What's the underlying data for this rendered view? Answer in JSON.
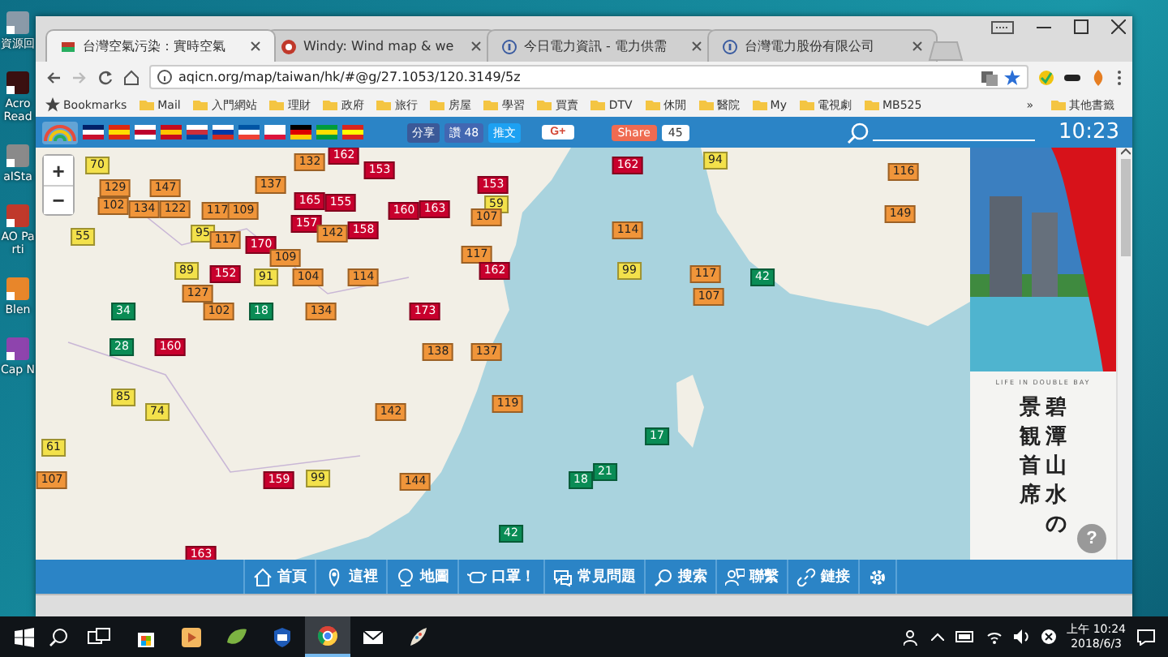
{
  "desktop": {
    "icons": [
      {
        "label": "資源回"
      },
      {
        "label": "Acro Read"
      },
      {
        "label": "aISta"
      },
      {
        "label": "AO Parti"
      },
      {
        "label": "Blen"
      },
      {
        "label": "Cap N"
      }
    ]
  },
  "browser": {
    "tabs": [
      {
        "title": "台灣空氣污染：實時空氣",
        "selected": true
      },
      {
        "title": "Windy: Wind map & we",
        "selected": false
      },
      {
        "title": "今日電力資訊 - 電力供需",
        "selected": false
      },
      {
        "title": "台灣電力股份有限公司",
        "selected": false
      }
    ],
    "address": "aqicn.org/map/taiwan/hk/#@g/27.1053/120.3149/5z",
    "bookmarks": [
      "Bookmarks",
      "Mail",
      "入門網站",
      "理財",
      "政府",
      "旅行",
      "房屋",
      "學習",
      "買賣",
      "DTV",
      "休閒",
      "醫院",
      "My",
      "電視劇",
      "MB525"
    ],
    "more": "»",
    "other_bookmarks": "其他書籤"
  },
  "site_toolbar": {
    "share": "分享",
    "like": "讚 48",
    "tweet": "推文",
    "gplus": "G+",
    "share_button": "Share",
    "share_count": "45",
    "time": "10:23"
  },
  "map": {
    "zoom_in": "+",
    "zoom_out": "−",
    "markers": [
      {
        "value": "70",
        "color": "#f3e14b"
      },
      {
        "value": "129",
        "color": "#f0953a"
      },
      {
        "value": "147",
        "color": "#f0953a"
      },
      {
        "value": "102",
        "color": "#f0953a"
      },
      {
        "value": "134",
        "color": "#f0953a"
      },
      {
        "value": "122",
        "color": "#f0953a"
      },
      {
        "value": "137",
        "color": "#f0953a"
      },
      {
        "value": "132",
        "color": "#f0953a"
      },
      {
        "value": "162",
        "color": "#c8002d"
      },
      {
        "value": "117",
        "color": "#f0953a"
      },
      {
        "value": "109",
        "color": "#f0953a"
      },
      {
        "value": "95",
        "color": "#f3e14b"
      },
      {
        "value": "117",
        "color": "#f0953a"
      },
      {
        "value": "170",
        "color": "#c8002d"
      },
      {
        "value": "109",
        "color": "#f0953a"
      },
      {
        "value": "157",
        "color": "#c8002d"
      },
      {
        "value": "142",
        "color": "#f0953a"
      },
      {
        "value": "158",
        "color": "#c8002d"
      },
      {
        "value": "165",
        "color": "#c8002d"
      },
      {
        "value": "155",
        "color": "#c8002d"
      },
      {
        "value": "153",
        "color": "#c8002d"
      },
      {
        "value": "160",
        "color": "#c8002d"
      },
      {
        "value": "163",
        "color": "#c8002d"
      },
      {
        "value": "153",
        "color": "#c8002d"
      },
      {
        "value": "59",
        "color": "#f3e14b"
      },
      {
        "value": "107",
        "color": "#f0953a"
      },
      {
        "value": "117",
        "color": "#f0953a"
      },
      {
        "value": "162",
        "color": "#c8002d"
      },
      {
        "value": "55",
        "color": "#f3e14b"
      },
      {
        "value": "89",
        "color": "#f3e14b"
      },
      {
        "value": "152",
        "color": "#c8002d"
      },
      {
        "value": "91",
        "color": "#f3e14b"
      },
      {
        "value": "104",
        "color": "#f0953a"
      },
      {
        "value": "114",
        "color": "#f0953a"
      },
      {
        "value": "127",
        "color": "#f0953a"
      },
      {
        "value": "34",
        "color": "#0a8c55"
      },
      {
        "value": "102",
        "color": "#f0953a"
      },
      {
        "value": "18",
        "color": "#0a8c55"
      },
      {
        "value": "134",
        "color": "#f0953a"
      },
      {
        "value": "173",
        "color": "#c8002d"
      },
      {
        "value": "28",
        "color": "#0a8c55"
      },
      {
        "value": "138",
        "color": "#f0953a"
      },
      {
        "value": "160",
        "color": "#c8002d"
      },
      {
        "value": "137",
        "color": "#f0953a"
      },
      {
        "value": "94",
        "color": "#f3e14b"
      },
      {
        "value": "162",
        "color": "#c8002d"
      },
      {
        "value": "116",
        "color": "#f0953a"
      },
      {
        "value": "149",
        "color": "#f0953a"
      },
      {
        "value": "114",
        "color": "#f0953a"
      },
      {
        "value": "99",
        "color": "#f3e14b"
      },
      {
        "value": "117",
        "color": "#f0953a"
      },
      {
        "value": "42",
        "color": "#0a8c55"
      },
      {
        "value": "107",
        "color": "#f0953a"
      },
      {
        "value": "18",
        "color": "#0a8c55"
      },
      {
        "value": "21",
        "color": "#0a8c55"
      },
      {
        "value": "17",
        "color": "#0a8c55"
      },
      {
        "value": "61",
        "color": "#f3e14b"
      },
      {
        "value": "107",
        "color": "#f0953a"
      },
      {
        "value": "74",
        "color": "#f3e14b"
      },
      {
        "value": "85",
        "color": "#f3e14b"
      },
      {
        "value": "163",
        "color": "#c8002d"
      },
      {
        "value": "159",
        "color": "#c8002d"
      },
      {
        "value": "99",
        "color": "#f3e14b"
      },
      {
        "value": "144",
        "color": "#f0953a"
      },
      {
        "value": "142",
        "color": "#f0953a"
      },
      {
        "value": "119",
        "color": "#f0953a"
      },
      {
        "value": "42",
        "color": "#0a8c55"
      }
    ]
  },
  "ad": {
    "tagline": "LIFE IN DOUBLE BAY",
    "headline_right": "碧潭山水の",
    "headline_left": "景観首席",
    "help": "?"
  },
  "nav": [
    {
      "label": "首頁"
    },
    {
      "label": "這裡"
    },
    {
      "label": "地圖"
    },
    {
      "label": "口罩！"
    },
    {
      "label": "常見問題"
    },
    {
      "label": "搜索"
    },
    {
      "label": "聯繫"
    },
    {
      "label": "鏈接"
    }
  ],
  "taskbar": {
    "apps": [
      {
        "selected": false
      },
      {
        "selected": false
      },
      {
        "selected": false
      },
      {
        "selected": false
      },
      {
        "selected": true
      },
      {
        "selected": false
      },
      {
        "selected": false
      }
    ],
    "time": "上午 10:24",
    "date": "2018/6/3"
  }
}
